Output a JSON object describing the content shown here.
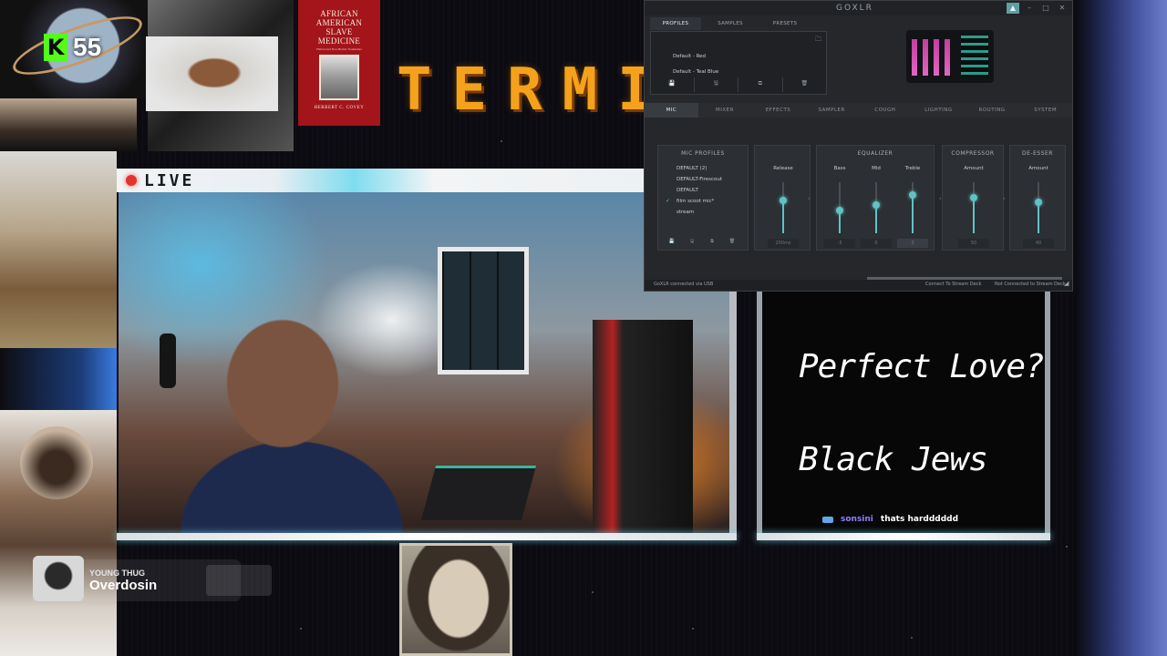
{
  "kick": {
    "count": "55",
    "logo": "K"
  },
  "book": {
    "title": "AFRICAN AMERICAN SLAVE MEDICINE",
    "subtitle": "Herbal and Non-Herbal Treatments",
    "author": "HERBERT C. COVEY"
  },
  "stream_title": "TERMIS",
  "live": {
    "label": "LIVE",
    "dot_color": "#e3342f"
  },
  "topic": {
    "line1": "Perfect Love?",
    "line2": "Black Jews"
  },
  "chat": {
    "user": "sonsini",
    "message": "thats hardddddd",
    "user_color": "#8f7dff"
  },
  "now_playing": {
    "artist": "YOUNG THUG",
    "track": "Overdosin"
  },
  "goxlr": {
    "logo": "GOXLR",
    "window_buttons": [
      "▲",
      "–",
      "□",
      "✕"
    ],
    "profile_tabs": [
      "PROFILES",
      "SAMPLES",
      "PRESETS"
    ],
    "profiles": [
      "Default - Red",
      "Default - Teal Blue"
    ],
    "profile_tools": [
      "💾",
      "🖫",
      "⧉",
      "🗑"
    ],
    "folder_icon": "🗀",
    "main_tabs": [
      "MIC",
      "MIXER",
      "EFFECTS",
      "SAMPLER",
      "COUGH",
      "LIGHTING",
      "ROUTING",
      "SYSTEM"
    ],
    "mic_profiles": {
      "title": "MIC PROFILES",
      "items": [
        "DEFAULT (2)",
        "DEFAULT-Firescout",
        "DEFAULT",
        "film scoot mic*",
        "stream"
      ],
      "active_index": 3,
      "check": "✓",
      "tools": [
        "💾",
        "🖫",
        "⧉",
        "🗑"
      ]
    },
    "release": {
      "label": "Release",
      "value": "200ms",
      "level": 0.65
    },
    "equalizer": {
      "title": "EQUALIZER",
      "bands": [
        {
          "label": "Bass",
          "value": "-3",
          "level": 0.45
        },
        {
          "label": "Mid",
          "value": "0",
          "level": 0.55
        },
        {
          "label": "Treble",
          "value": "3",
          "level": 0.75
        }
      ]
    },
    "compressor": {
      "title": "COMPRESSOR",
      "label": "Amount",
      "value": "50",
      "level": 0.7
    },
    "deesser": {
      "title": "DE-ESSER",
      "label": "Amount",
      "value": "40",
      "level": 0.6
    },
    "arrows": [
      "‹",
      "›",
      "›"
    ],
    "status": {
      "left": "GoXLR connected via USB",
      "middle": "Connect To Stream Deck",
      "right": "Not Connected to Stream Deck",
      "grip": "◢"
    },
    "accent": "#5fc3c5"
  }
}
